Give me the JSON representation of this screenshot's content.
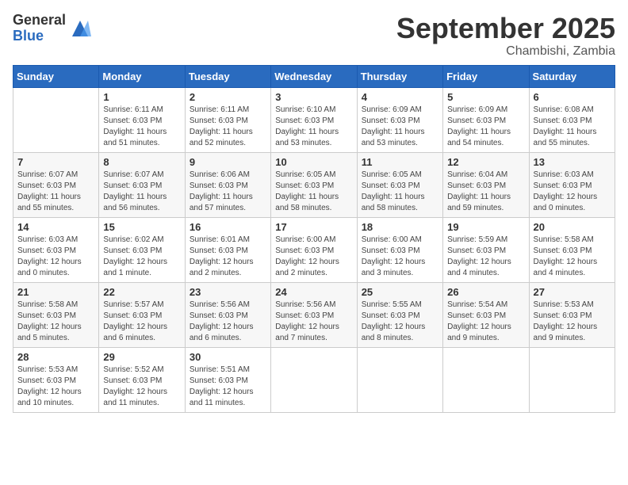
{
  "logo": {
    "general": "General",
    "blue": "Blue"
  },
  "title": "September 2025",
  "location": "Chambishi, Zambia",
  "headers": [
    "Sunday",
    "Monday",
    "Tuesday",
    "Wednesday",
    "Thursday",
    "Friday",
    "Saturday"
  ],
  "weeks": [
    [
      {
        "day": "",
        "sunrise": "",
        "sunset": "",
        "daylight": ""
      },
      {
        "day": "1",
        "sunrise": "Sunrise: 6:11 AM",
        "sunset": "Sunset: 6:03 PM",
        "daylight": "Daylight: 11 hours and 51 minutes."
      },
      {
        "day": "2",
        "sunrise": "Sunrise: 6:11 AM",
        "sunset": "Sunset: 6:03 PM",
        "daylight": "Daylight: 11 hours and 52 minutes."
      },
      {
        "day": "3",
        "sunrise": "Sunrise: 6:10 AM",
        "sunset": "Sunset: 6:03 PM",
        "daylight": "Daylight: 11 hours and 53 minutes."
      },
      {
        "day": "4",
        "sunrise": "Sunrise: 6:09 AM",
        "sunset": "Sunset: 6:03 PM",
        "daylight": "Daylight: 11 hours and 53 minutes."
      },
      {
        "day": "5",
        "sunrise": "Sunrise: 6:09 AM",
        "sunset": "Sunset: 6:03 PM",
        "daylight": "Daylight: 11 hours and 54 minutes."
      },
      {
        "day": "6",
        "sunrise": "Sunrise: 6:08 AM",
        "sunset": "Sunset: 6:03 PM",
        "daylight": "Daylight: 11 hours and 55 minutes."
      }
    ],
    [
      {
        "day": "7",
        "sunrise": "Sunrise: 6:07 AM",
        "sunset": "Sunset: 6:03 PM",
        "daylight": "Daylight: 11 hours and 55 minutes."
      },
      {
        "day": "8",
        "sunrise": "Sunrise: 6:07 AM",
        "sunset": "Sunset: 6:03 PM",
        "daylight": "Daylight: 11 hours and 56 minutes."
      },
      {
        "day": "9",
        "sunrise": "Sunrise: 6:06 AM",
        "sunset": "Sunset: 6:03 PM",
        "daylight": "Daylight: 11 hours and 57 minutes."
      },
      {
        "day": "10",
        "sunrise": "Sunrise: 6:05 AM",
        "sunset": "Sunset: 6:03 PM",
        "daylight": "Daylight: 11 hours and 58 minutes."
      },
      {
        "day": "11",
        "sunrise": "Sunrise: 6:05 AM",
        "sunset": "Sunset: 6:03 PM",
        "daylight": "Daylight: 11 hours and 58 minutes."
      },
      {
        "day": "12",
        "sunrise": "Sunrise: 6:04 AM",
        "sunset": "Sunset: 6:03 PM",
        "daylight": "Daylight: 11 hours and 59 minutes."
      },
      {
        "day": "13",
        "sunrise": "Sunrise: 6:03 AM",
        "sunset": "Sunset: 6:03 PM",
        "daylight": "Daylight: 12 hours and 0 minutes."
      }
    ],
    [
      {
        "day": "14",
        "sunrise": "Sunrise: 6:03 AM",
        "sunset": "Sunset: 6:03 PM",
        "daylight": "Daylight: 12 hours and 0 minutes."
      },
      {
        "day": "15",
        "sunrise": "Sunrise: 6:02 AM",
        "sunset": "Sunset: 6:03 PM",
        "daylight": "Daylight: 12 hours and 1 minute."
      },
      {
        "day": "16",
        "sunrise": "Sunrise: 6:01 AM",
        "sunset": "Sunset: 6:03 PM",
        "daylight": "Daylight: 12 hours and 2 minutes."
      },
      {
        "day": "17",
        "sunrise": "Sunrise: 6:00 AM",
        "sunset": "Sunset: 6:03 PM",
        "daylight": "Daylight: 12 hours and 2 minutes."
      },
      {
        "day": "18",
        "sunrise": "Sunrise: 6:00 AM",
        "sunset": "Sunset: 6:03 PM",
        "daylight": "Daylight: 12 hours and 3 minutes."
      },
      {
        "day": "19",
        "sunrise": "Sunrise: 5:59 AM",
        "sunset": "Sunset: 6:03 PM",
        "daylight": "Daylight: 12 hours and 4 minutes."
      },
      {
        "day": "20",
        "sunrise": "Sunrise: 5:58 AM",
        "sunset": "Sunset: 6:03 PM",
        "daylight": "Daylight: 12 hours and 4 minutes."
      }
    ],
    [
      {
        "day": "21",
        "sunrise": "Sunrise: 5:58 AM",
        "sunset": "Sunset: 6:03 PM",
        "daylight": "Daylight: 12 hours and 5 minutes."
      },
      {
        "day": "22",
        "sunrise": "Sunrise: 5:57 AM",
        "sunset": "Sunset: 6:03 PM",
        "daylight": "Daylight: 12 hours and 6 minutes."
      },
      {
        "day": "23",
        "sunrise": "Sunrise: 5:56 AM",
        "sunset": "Sunset: 6:03 PM",
        "daylight": "Daylight: 12 hours and 6 minutes."
      },
      {
        "day": "24",
        "sunrise": "Sunrise: 5:56 AM",
        "sunset": "Sunset: 6:03 PM",
        "daylight": "Daylight: 12 hours and 7 minutes."
      },
      {
        "day": "25",
        "sunrise": "Sunrise: 5:55 AM",
        "sunset": "Sunset: 6:03 PM",
        "daylight": "Daylight: 12 hours and 8 minutes."
      },
      {
        "day": "26",
        "sunrise": "Sunrise: 5:54 AM",
        "sunset": "Sunset: 6:03 PM",
        "daylight": "Daylight: 12 hours and 9 minutes."
      },
      {
        "day": "27",
        "sunrise": "Sunrise: 5:53 AM",
        "sunset": "Sunset: 6:03 PM",
        "daylight": "Daylight: 12 hours and 9 minutes."
      }
    ],
    [
      {
        "day": "28",
        "sunrise": "Sunrise: 5:53 AM",
        "sunset": "Sunset: 6:03 PM",
        "daylight": "Daylight: 12 hours and 10 minutes."
      },
      {
        "day": "29",
        "sunrise": "Sunrise: 5:52 AM",
        "sunset": "Sunset: 6:03 PM",
        "daylight": "Daylight: 12 hours and 11 minutes."
      },
      {
        "day": "30",
        "sunrise": "Sunrise: 5:51 AM",
        "sunset": "Sunset: 6:03 PM",
        "daylight": "Daylight: 12 hours and 11 minutes."
      },
      {
        "day": "",
        "sunrise": "",
        "sunset": "",
        "daylight": ""
      },
      {
        "day": "",
        "sunrise": "",
        "sunset": "",
        "daylight": ""
      },
      {
        "day": "",
        "sunrise": "",
        "sunset": "",
        "daylight": ""
      },
      {
        "day": "",
        "sunrise": "",
        "sunset": "",
        "daylight": ""
      }
    ]
  ]
}
